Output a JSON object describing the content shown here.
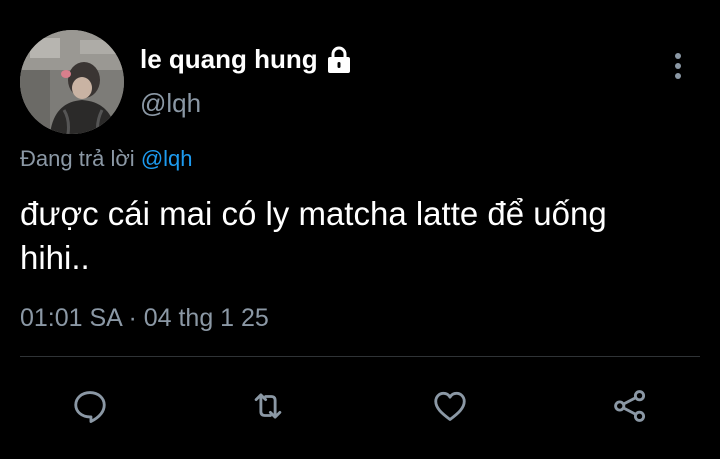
{
  "author": {
    "display_name": "le quang hung",
    "handle": "@lqh",
    "protected_icon": "lock-icon"
  },
  "menu": {
    "icon": "more-vertical-icon"
  },
  "reply_context": {
    "prefix": "Đang trả lời ",
    "mention": "@lqh"
  },
  "tweet": {
    "line1": "được cái mai có ly matcha latte để uống",
    "line2": "hihi..",
    "time": "01:01 SA",
    "separator": "·",
    "date": "04 thg 1 25"
  },
  "actions": [
    {
      "icon": "reply-icon"
    },
    {
      "icon": "retweet-icon"
    },
    {
      "icon": "like-icon"
    },
    {
      "icon": "share-icon"
    }
  ],
  "colors": {
    "background": "#000000",
    "text": "#ffffff",
    "secondary": "#8b98a5",
    "accent": "#1d9bf0",
    "divider": "#2f3336"
  }
}
